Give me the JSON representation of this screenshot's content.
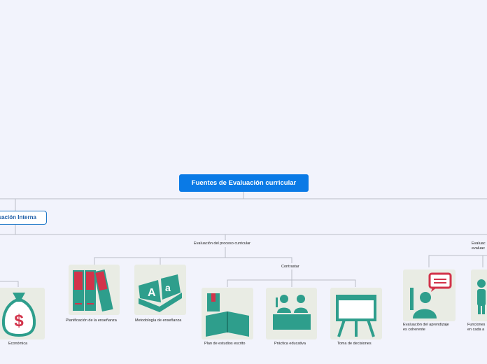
{
  "central_topic": "Fuentes de Evaluación curricular",
  "main_topic": "luación Interna",
  "branches": {
    "proceso": "Evaluación del proceso curricular",
    "contrastar": "Contrastar",
    "right_partial_1": "Evaluac",
    "right_partial_2": "evaluac"
  },
  "cards": {
    "economica": "Económica",
    "planificacion": "Planificación de la enseñanza",
    "metodologia": "Metodología de enseñanza",
    "plan_estudios": "Plan de estudios escrito",
    "practica": "Práctica educativa",
    "toma": "Toma de decisiones",
    "aprendizaje_1": "Evaluación del aprendizaje",
    "aprendizaje_2": "es coherente",
    "funciones_1": "Funciones",
    "funciones_2": "en cada a"
  },
  "colors": {
    "central_fill": "#0a7ae6",
    "line": "#b9bcc6",
    "icon_teal": "#2e9e8c",
    "icon_red": "#d2334a",
    "card_bg": "#e9ece4"
  }
}
